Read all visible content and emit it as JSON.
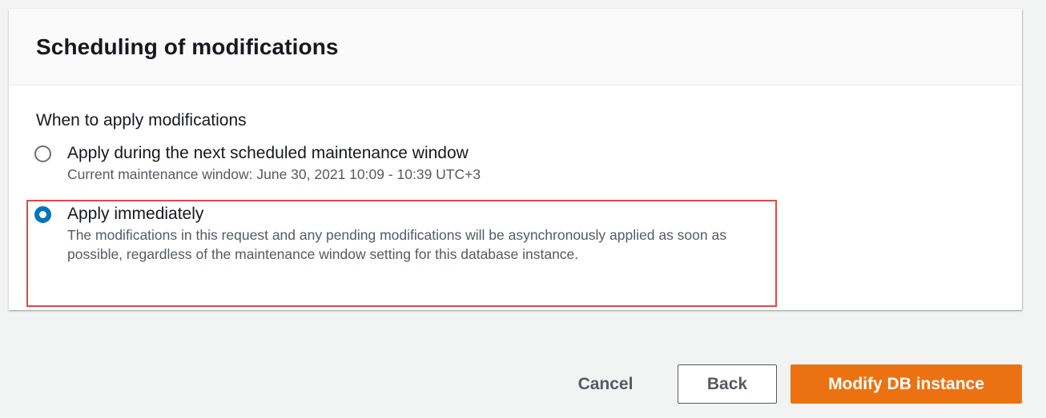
{
  "panel": {
    "title": "Scheduling of modifications"
  },
  "field": {
    "label": "When to apply modifications",
    "options": [
      {
        "label": "Apply during the next scheduled maintenance window",
        "description": "Current maintenance window: June 30, 2021 10:09 - 10:39 UTC+3",
        "selected": false
      },
      {
        "label": "Apply immediately",
        "description": "The modifications in this request and any pending modifications will be asynchronously applied as soon as possible, regardless of the maintenance window setting for this database instance.",
        "selected": true
      }
    ]
  },
  "actions": {
    "cancel_label": "Cancel",
    "back_label": "Back",
    "primary_label": "Modify DB instance"
  },
  "colors": {
    "accent": "#0073bb",
    "primary_button": "#ec7211",
    "highlight_border": "#e0484a"
  }
}
